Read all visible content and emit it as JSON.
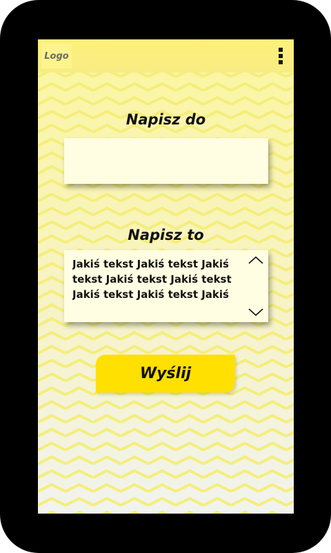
{
  "header": {
    "logo_label": "Logo",
    "menu_icon": "more-vertical-icon"
  },
  "form": {
    "recipient_label": "Napisz do",
    "recipient_value": "",
    "message_label": "Napisz to",
    "message_value": "Jakiś tekst Jakiś tekst Jakiś tekst Jakiś tekst Jakiś tekst Jakiś tekst Jakiś tekst Jakiś",
    "scroll_up_icon": "chevron-up-icon",
    "scroll_down_icon": "chevron-down-icon",
    "send_label": "Wyślij"
  },
  "colors": {
    "device": "#000000",
    "accent": "#ffe000",
    "field_bg": "#fffde2",
    "text": "#111111"
  }
}
